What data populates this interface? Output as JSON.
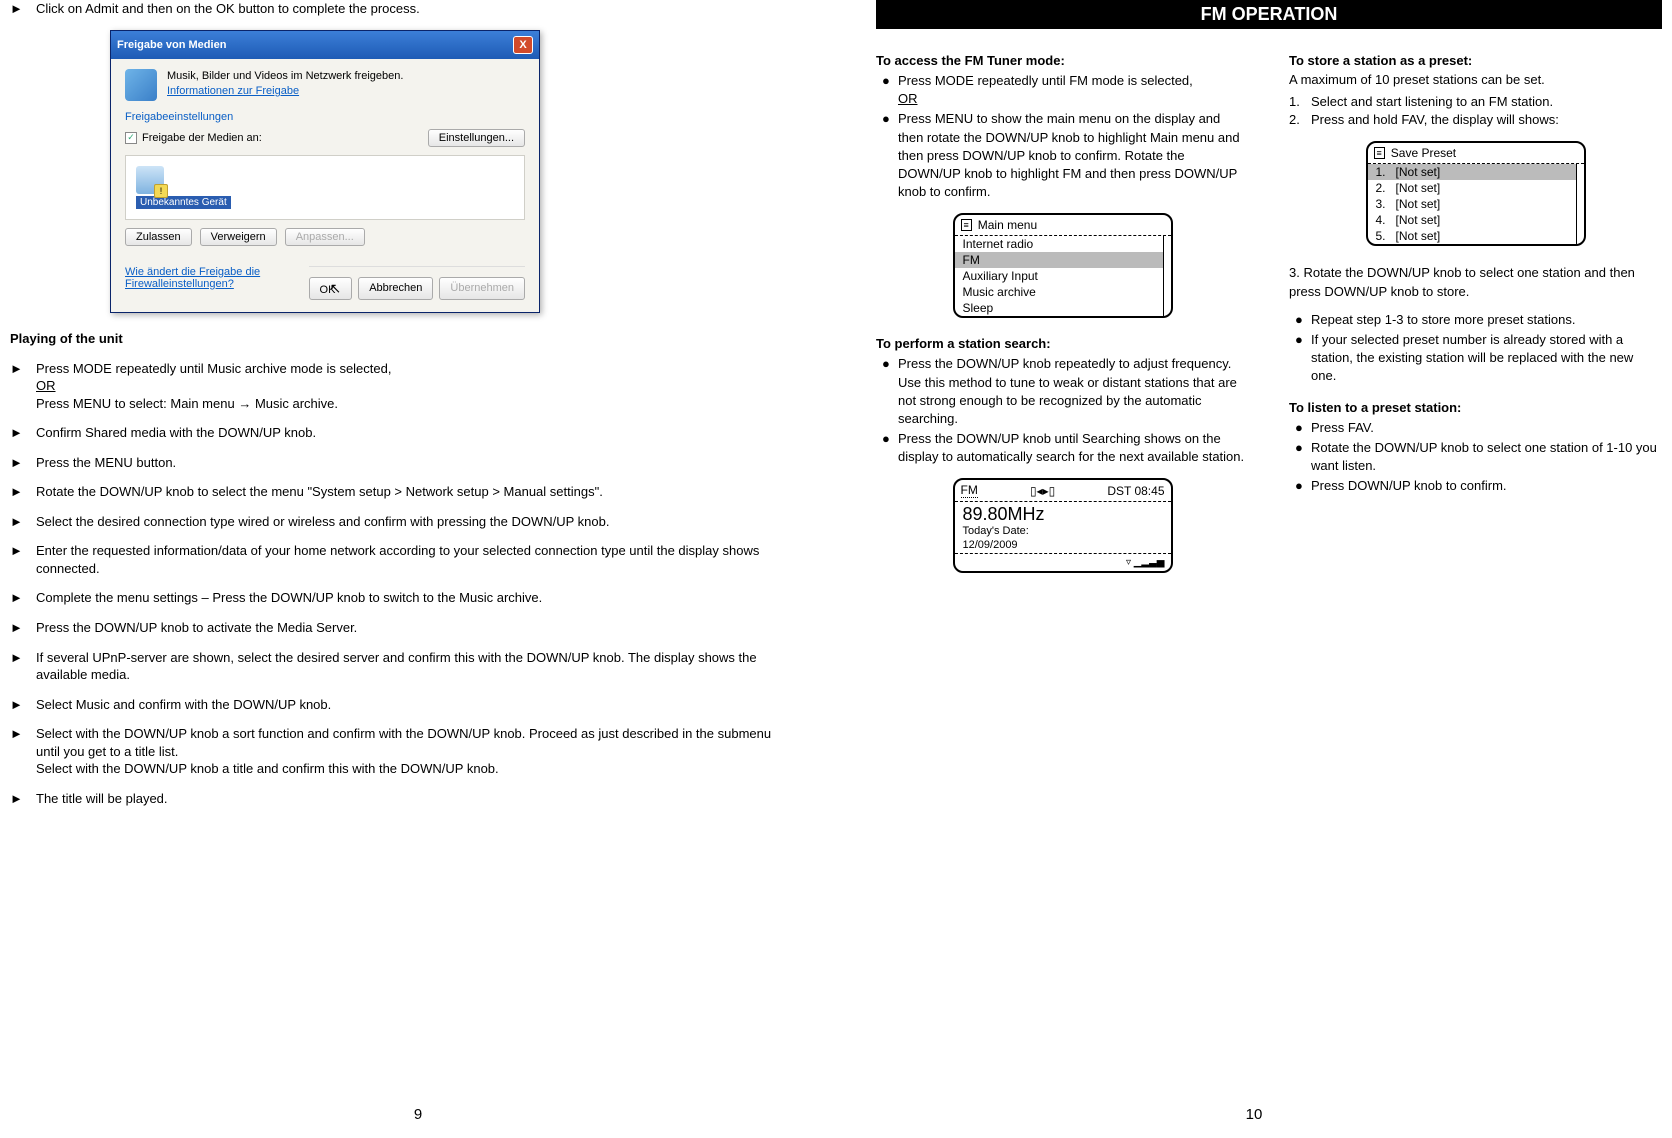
{
  "left": {
    "top_instruction": "Click on Admit and then on the OK button to complete the process.",
    "dialog": {
      "title": "Freigabe von Medien",
      "desc": "Musik, Bilder und Videos im Netzwerk freigeben.",
      "link1": "Informationen zur Freigabe",
      "section_link": "Freigabeeinstellungen",
      "checkbox_label": "Freigabe der Medien an:",
      "settings_btn": "Einstellungen...",
      "device_label": "Unbekanntes Gerät",
      "btn_allow": "Zulassen",
      "btn_deny": "Verweigern",
      "btn_adjust": "Anpassen...",
      "footer_q": "Wie ändert die Freigabe die Firewalleinstellungen?",
      "ok": "OK",
      "cancel": "Abbrechen",
      "apply": "Übernehmen"
    },
    "playing_heading": "Playing of the unit",
    "steps": {
      "s1a": "Press MODE repeatedly until Music archive mode is selected,",
      "s1b": "OR",
      "s1c_pre": "Press MENU to select: Main menu",
      "s1c_post": "Music archive.",
      "s2": "Confirm Shared media with the DOWN/UP knob.",
      "s3": "Press the MENU button.",
      "s4": "Rotate the DOWN/UP knob to select the menu \"System setup > Network setup > Manual settings\".",
      "s5": "Select the desired connection type wired or wireless and confirm with pressing the DOWN/UP knob.",
      "s6": "Enter the requested information/data of your home network according to your selected connection type until the display shows connected.",
      "s7": "Complete the menu settings – Press the DOWN/UP knob to switch to the Music archive.",
      "s8": "Press the DOWN/UP knob to activate the Media Server.",
      "s9": "If several UPnP-server are shown, select the desired server and confirm this with the DOWN/UP knob. The display shows the available media.",
      "s10": "Select Music and confirm with the DOWN/UP knob.",
      "s11a": "Select with the DOWN/UP knob a sort function and confirm with the DOWN/UP knob. Proceed as just described in the submenu until you get to a title list.",
      "s11b": "Select with the DOWN/UP knob a title and confirm this with the DOWN/UP knob.",
      "s12": "The title will be played."
    },
    "page_num": "9"
  },
  "right": {
    "header": "FM OPERATION",
    "colA": {
      "h1": "To access the FM Tuner mode:",
      "b1a": "Press MODE repeatedly until FM mode is selected,",
      "b1b": "OR",
      "b2": "Press MENU to show the main menu on the display and then rotate the DOWN/UP knob to highlight Main menu and then press DOWN/UP knob to confirm.  Rotate the DOWN/UP knob to highlight FM and then press DOWN/UP knob to confirm.",
      "menu_title": "Main menu",
      "menu_items": [
        "Internet radio",
        "FM",
        "Auxiliary Input",
        "Music archive",
        "Sleep"
      ],
      "h2": "To perform a station search:",
      "b3": "Press the DOWN/UP knob repeatedly to adjust frequency. Use this method to tune to weak or distant stations that are not strong enough to be recognized by the automatic searching.",
      "b4": "Press the DOWN/UP knob until Searching shows on the display to automatically search for the next available station.",
      "fm_mode": "FM",
      "fm_time": "DST 08:45",
      "fm_freq": "89.80MHz",
      "fm_date_label": "Today's Date:",
      "fm_date": "12/09/2009"
    },
    "colB": {
      "h1": "To store a station as a preset:",
      "sub": "A maximum of 10 preset stations can be set.",
      "n1": "Select and start listening to an FM station.",
      "n2": "Press and hold FAV, the display will shows:",
      "preset_title": "Save Preset",
      "presets": [
        {
          "n": "1.",
          "v": "[Not set]"
        },
        {
          "n": "2.",
          "v": "[Not set]"
        },
        {
          "n": "3.",
          "v": "[Not set]"
        },
        {
          "n": "4.",
          "v": "[Not set]"
        },
        {
          "n": "5.",
          "v": "[Not set]"
        }
      ],
      "n3": "3.  Rotate the DOWN/UP knob to select one station and then press DOWN/UP knob to store.",
      "b1": "Repeat step 1-3 to store more preset stations.",
      "b2": "If your selected preset number is already stored with a station, the existing station will be replaced with the new one.",
      "h2": "To listen to a preset station:",
      "b3": "Press FAV.",
      "b4": "Rotate the DOWN/UP knob to select one station of 1-10 you want listen.",
      "b5": "Press DOWN/UP knob to confirm."
    },
    "page_num": "10"
  }
}
